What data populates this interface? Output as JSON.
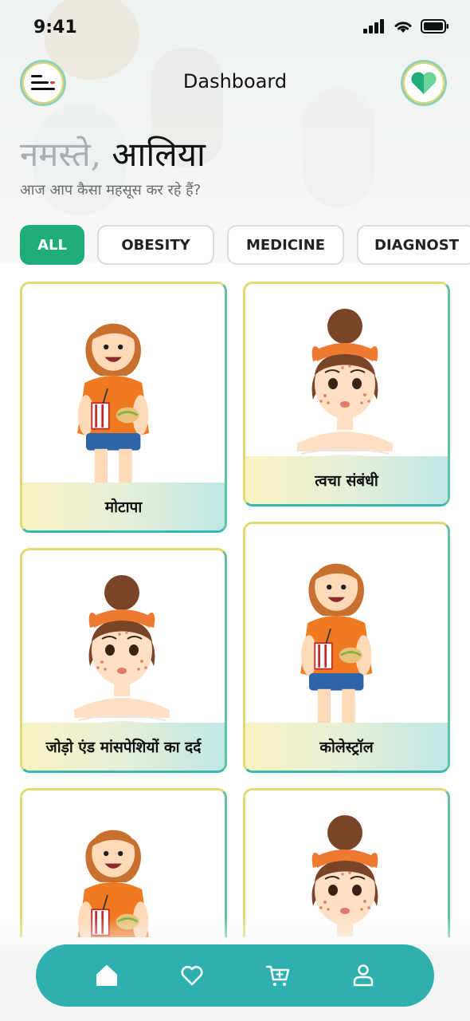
{
  "status_bar": {
    "time": "9:41"
  },
  "header": {
    "title": "Dashboard"
  },
  "greeting": {
    "word": "नमस्ते,",
    "name": "आलिया",
    "subtitle": "आज आप कैसा महसूस कर रहे हैं?"
  },
  "filters": {
    "selected": "ALL",
    "items": [
      "ALL",
      "OBESITY",
      "MEDICINE",
      "DIAGNOST"
    ]
  },
  "cards": [
    {
      "label": "मोटापा",
      "illustration": "obese-woman"
    },
    {
      "label": "त्वचा संबंधी",
      "illustration": "acne-girl"
    },
    {
      "label": "जोड़ो एंड मांसपेशियों का दर्द",
      "illustration": "acne-girl"
    },
    {
      "label": "कोलेस्ट्रॉल",
      "illustration": "obese-woman"
    },
    {
      "label": "",
      "illustration": "obese-woman"
    },
    {
      "label": "",
      "illustration": "acne-girl"
    }
  ],
  "bottom_nav": {
    "items": [
      "home-icon",
      "heart-icon",
      "cart-icon",
      "user-icon"
    ]
  },
  "colors": {
    "accent": "#1fae79",
    "nav": "#2fb0b0",
    "card_border_top": "#e2d970",
    "card_border_bottom": "#38b7b1"
  }
}
